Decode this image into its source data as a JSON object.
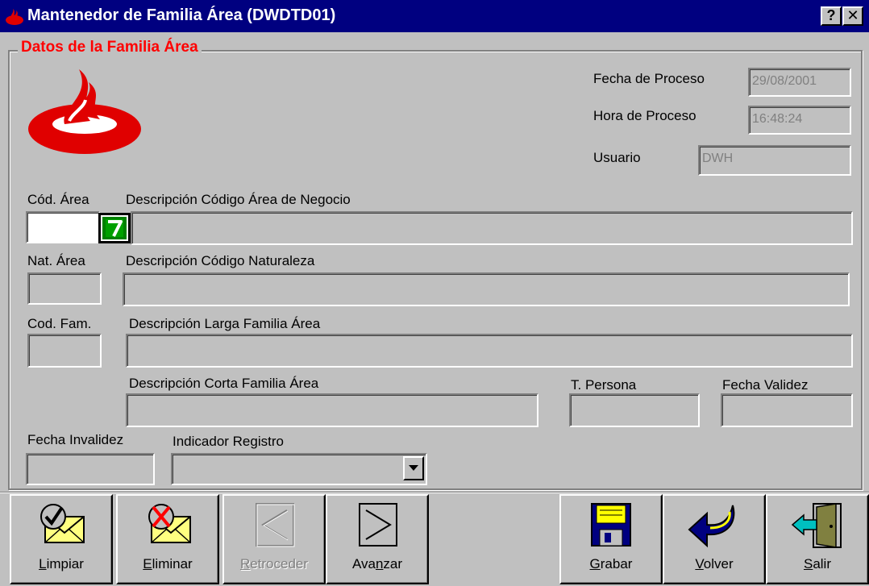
{
  "window": {
    "title": "Mantenedor de Familia Área (DWDTD01)",
    "help_label": "?",
    "close_label": "✕"
  },
  "frame": {
    "legend": "Datos de la Familia Área"
  },
  "process": {
    "fecha_label": "Fecha de Proceso",
    "fecha_value": "29/08/2001",
    "hora_label": "Hora de Proceso",
    "hora_value": "16:48:24",
    "usuario_label": "Usuario",
    "usuario_value": "DWH"
  },
  "form": {
    "cod_area_label": "Cód. Área",
    "desc_area_label": "Descripción Código Área de Negocio",
    "nat_area_label": "Nat. Área",
    "desc_nat_label": "Descripción Código Naturaleza",
    "cod_fam_label": "Cod. Fam.",
    "desc_larga_label": "Descripción Larga Familia Área",
    "desc_corta_label": "Descripción Corta Familia Área",
    "t_persona_label": "T. Persona",
    "fecha_validez_label": "Fecha Validez",
    "fecha_invalidez_label": "Fecha Invalidez",
    "indicador_label": "Indicador Registro",
    "indicador_value": ""
  },
  "toolbar": {
    "limpiar": "Limpiar",
    "eliminar": "Eliminar",
    "retroceder": "Retroceder",
    "avanzar": "Avanzar",
    "grabar": "Grabar",
    "volver": "Volver",
    "salir": "Salir"
  },
  "colors": {
    "title_bar": "#000080",
    "legend": "#ff0000",
    "logo": "#e00000",
    "lookup": "#008000"
  },
  "icons": {
    "app": "santander-flame-icon",
    "lookup": "lookup-list-icon",
    "limpiar": "envelope-check-icon",
    "eliminar": "envelope-x-icon",
    "retroceder": "arrow-left-icon",
    "avanzar": "arrow-right-icon",
    "grabar": "floppy-disk-icon",
    "volver": "return-arrow-icon",
    "salir": "exit-door-icon"
  }
}
